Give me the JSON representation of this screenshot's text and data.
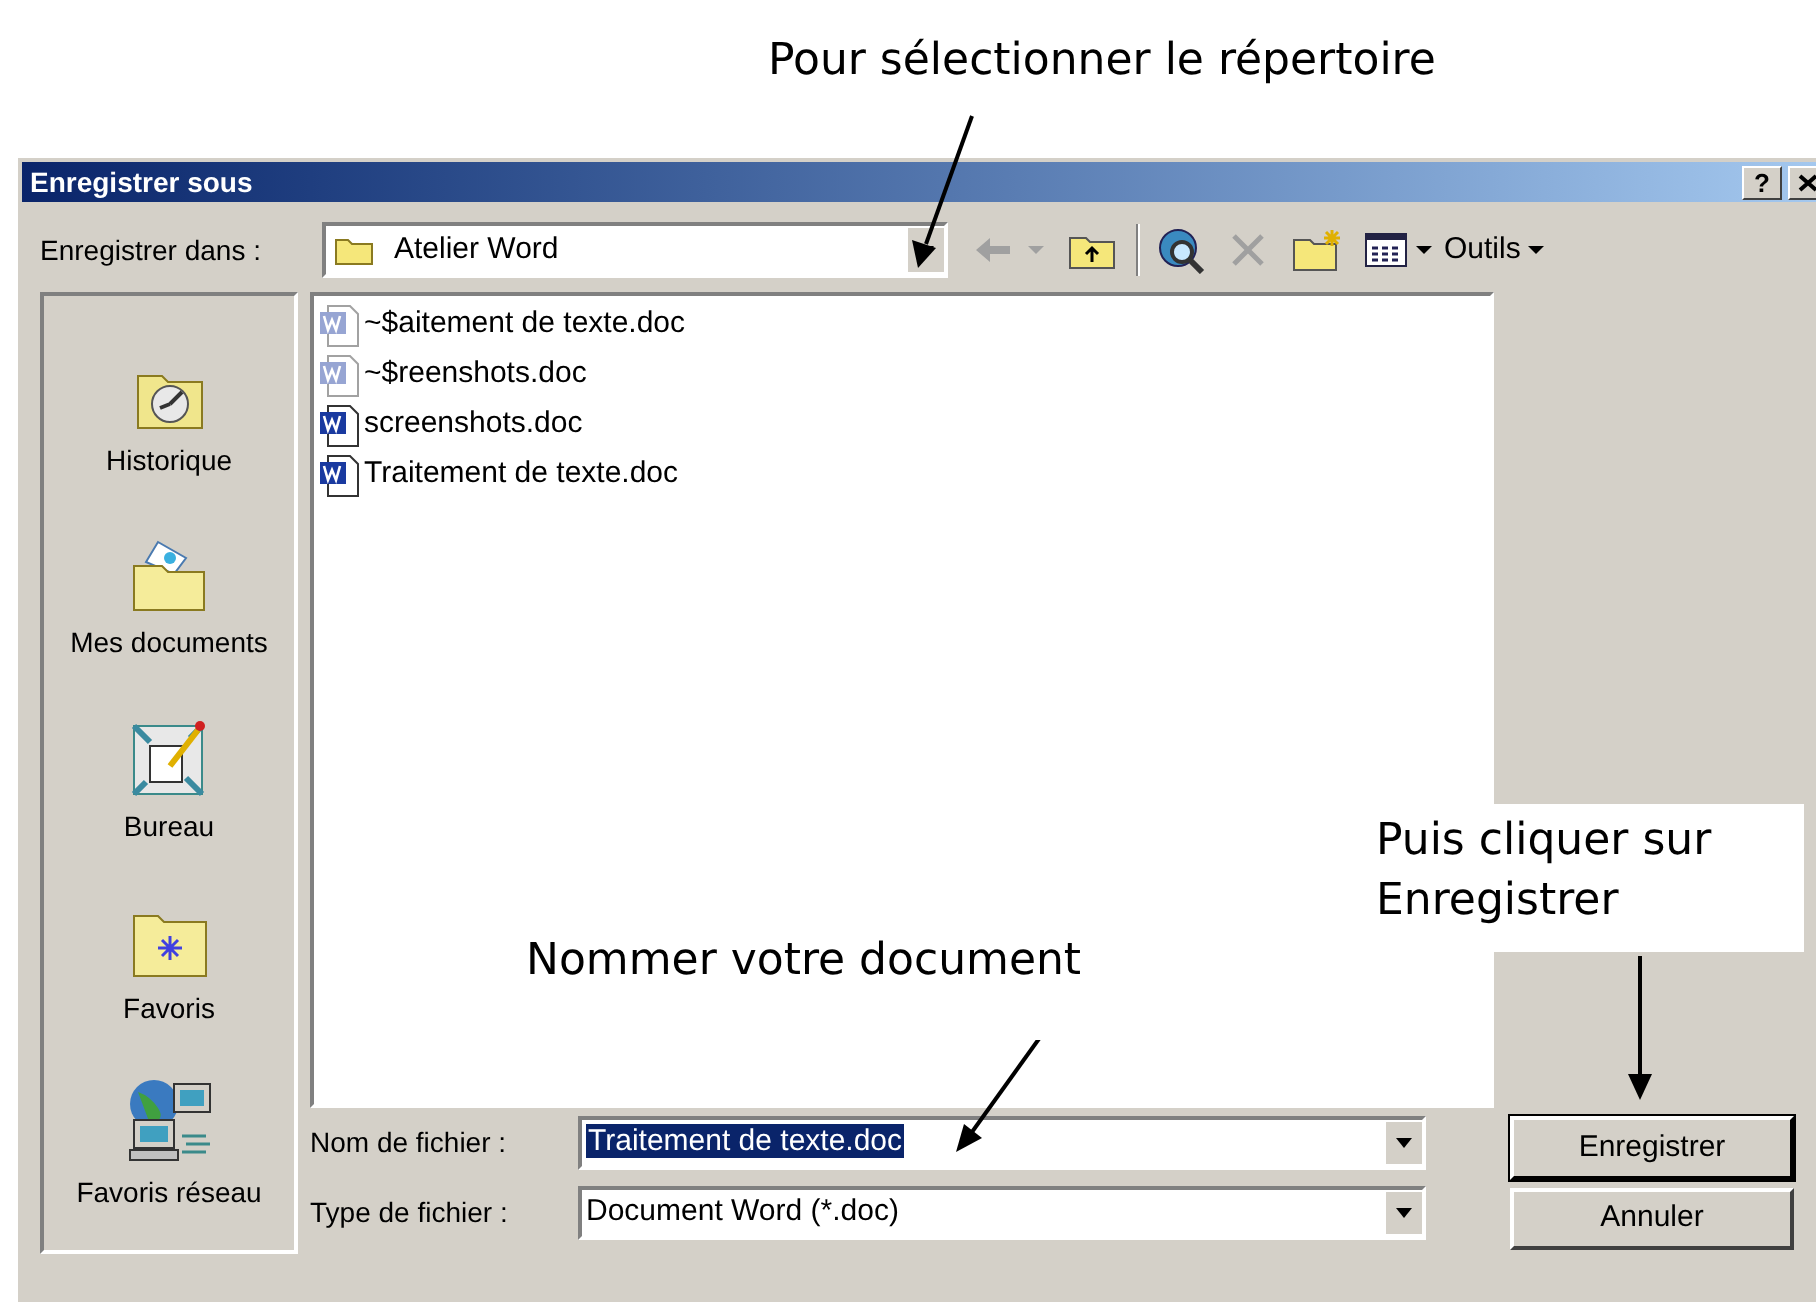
{
  "window": {
    "title": "Enregistrer sous",
    "help_button": "?"
  },
  "save_in": {
    "label": "Enregistrer dans :",
    "value": "Atelier Word"
  },
  "toolbar": {
    "tools_menu": "Outils"
  },
  "places": [
    {
      "label": "Historique",
      "kind": "history"
    },
    {
      "label": "Mes documents",
      "kind": "documents"
    },
    {
      "label": "Bureau",
      "kind": "desktop"
    },
    {
      "label": "Favoris",
      "kind": "favorites"
    },
    {
      "label": "Favoris réseau",
      "kind": "network"
    }
  ],
  "files": [
    {
      "name": "~$aitement de texte.doc",
      "hidden": true
    },
    {
      "name": "~$reenshots.doc",
      "hidden": true
    },
    {
      "name": "screenshots.doc",
      "hidden": false
    },
    {
      "name": "Traitement de texte.doc",
      "hidden": false
    }
  ],
  "file_name": {
    "label": "Nom de fichier :",
    "value": "Traitement de texte.doc",
    "selected": true
  },
  "file_type": {
    "label": "Type de fichier :",
    "value": "Document Word (*.doc)"
  },
  "buttons": [
    {
      "label": "Enregistrer",
      "default": true
    },
    {
      "label": "Annuler",
      "default": false
    }
  ],
  "annotations": [
    {
      "text": "Pour sélectionner le répertoire"
    },
    {
      "text": "Nommer votre document"
    },
    {
      "text": "Puis cliquer sur Enregistrer"
    }
  ]
}
